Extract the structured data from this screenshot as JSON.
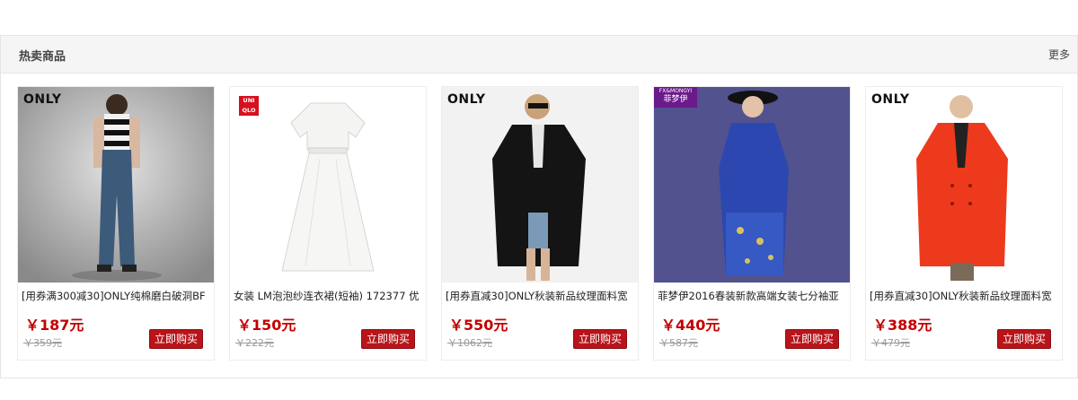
{
  "section": {
    "title": "热卖商品",
    "more": "更多"
  },
  "products": [
    {
      "brand": "ONLY",
      "title": "[用券满300减30]ONLY纯棉磨白破洞BF",
      "price": "￥187元",
      "old_price": "￥359元",
      "buy": "立即购买"
    },
    {
      "brand": "UNI QLO",
      "title": "女装 LM泡泡纱连衣裙(短袖) 172377 优",
      "price": "￥150元",
      "old_price": "￥222元",
      "buy": "立即购买"
    },
    {
      "brand": "ONLY",
      "title": "[用券直减30]ONLY秋装新品纹理面料宽",
      "price": "￥550元",
      "old_price": "￥1062元",
      "buy": "立即购买"
    },
    {
      "brand": "FX&MONGYI",
      "brand_cn": "菲梦伊",
      "title": "菲梦伊2016春装新款高端女装七分袖亚",
      "price": "￥440元",
      "old_price": "￥587元",
      "buy": "立即购买"
    },
    {
      "brand": "ONLY",
      "title": "[用券直减30]ONLY秋装新品纹理面料宽",
      "price": "￥388元",
      "old_price": "￥479元",
      "buy": "立即购买"
    }
  ]
}
